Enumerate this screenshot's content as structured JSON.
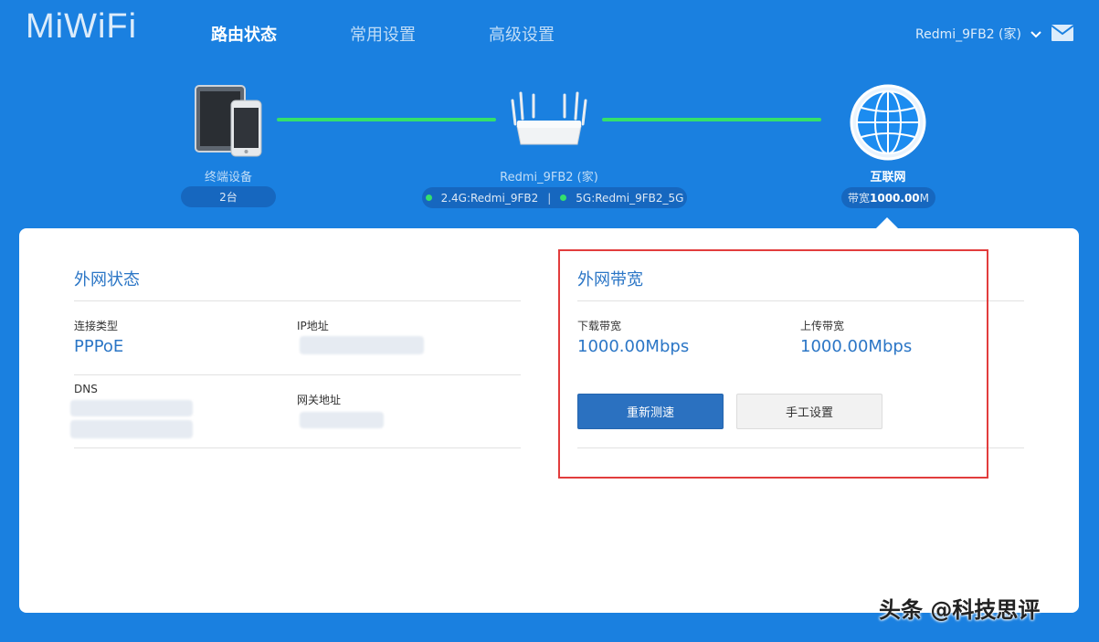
{
  "header": {
    "logo": "MiWiFi",
    "nav": [
      {
        "label": "路由状态",
        "active": true
      },
      {
        "label": "常用设置",
        "active": false
      },
      {
        "label": "高级设置",
        "active": false
      }
    ],
    "account": "Redmi_9FB2 (家)"
  },
  "topology": {
    "devices": {
      "label": "终端设备",
      "count": "2台"
    },
    "router": {
      "label": "Redmi_9FB2 (家)",
      "wifi_24": "2.4G:Redmi_9FB2",
      "wifi_5": "5G:Redmi_9FB2_5G",
      "separator": "|"
    },
    "internet": {
      "label": "互联网",
      "bandwidth_prefix": "带宽",
      "bandwidth_value": "1000.00",
      "bandwidth_unit": "M"
    }
  },
  "wan_status": {
    "title": "外网状态",
    "connection_type_label": "连接类型",
    "connection_type_value": "PPPoE",
    "ip_label": "IP地址",
    "dns_label": "DNS",
    "gateway_label": "网关地址"
  },
  "wan_bandwidth": {
    "title": "外网带宽",
    "download_label": "下载带宽",
    "download_value": "1000.00Mbps",
    "upload_label": "上传带宽",
    "upload_value": "1000.00Mbps",
    "retest_button": "重新测速",
    "manual_button": "手工设置"
  },
  "watermark": "头条 @科技思评",
  "colors": {
    "background": "#1a80e0",
    "accent": "#2b76c6",
    "link_line": "#34e06c",
    "highlight": "#e23d3d"
  }
}
